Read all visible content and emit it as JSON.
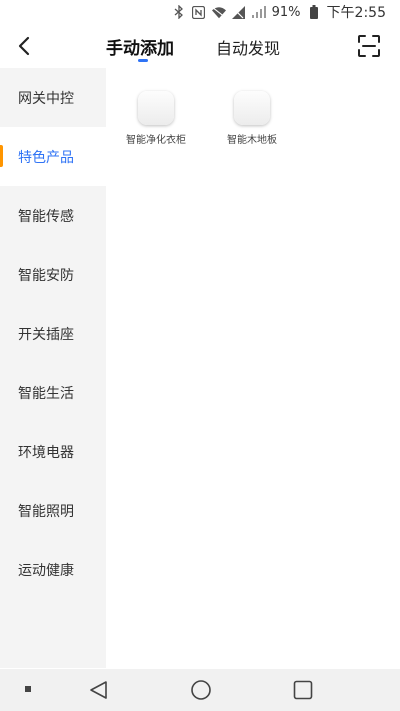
{
  "status_bar": {
    "battery_percent": "91%",
    "time": "下午2:55",
    "icons": [
      "bluetooth-icon",
      "nfc-icon",
      "wifi-icon",
      "no-sim-icon",
      "signal-icon",
      "battery-icon"
    ]
  },
  "header": {
    "tabs": [
      {
        "label": "手动添加",
        "active": true
      },
      {
        "label": "自动发现",
        "active": false
      }
    ],
    "accent_color": "#2f73f5"
  },
  "sidebar": {
    "items": [
      {
        "label": "网关中控",
        "active": false
      },
      {
        "label": "特色产品",
        "active": true
      },
      {
        "label": "智能传感",
        "active": false
      },
      {
        "label": "智能安防",
        "active": false
      },
      {
        "label": "开关插座",
        "active": false
      },
      {
        "label": "智能生活",
        "active": false
      },
      {
        "label": "环境电器",
        "active": false
      },
      {
        "label": "智能照明",
        "active": false
      },
      {
        "label": "运动健康",
        "active": false
      }
    ],
    "indicator_color": "#ff9500"
  },
  "products": [
    {
      "label": "智能净化衣柜"
    },
    {
      "label": "智能木地板"
    }
  ]
}
